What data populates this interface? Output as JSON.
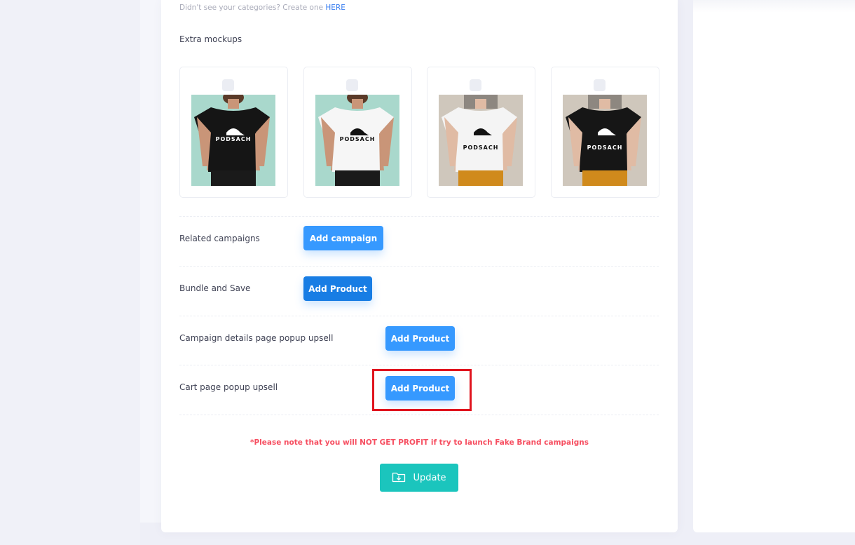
{
  "hint": {
    "text": "Didn't see your categories? Create one",
    "link": "HERE"
  },
  "extra_mockups": {
    "label": "Extra mockups",
    "items": [
      {
        "shirt": "#151515",
        "background": "#a9d8cc",
        "skin": "#c99578",
        "brand": "PODSACH",
        "model": "man"
      },
      {
        "shirt": "#f6f6f6",
        "background": "#a9d8cc",
        "skin": "#c99578",
        "brand": "PODSACH",
        "model": "man"
      },
      {
        "shirt": "#f4f4f4",
        "background": "#cfc7bc",
        "skin": "#e0bba4",
        "brand": "PODSACH",
        "model": "woman"
      },
      {
        "shirt": "#161616",
        "background": "#cfc7bc",
        "skin": "#e0bba4",
        "brand": "PODSACH",
        "model": "woman"
      }
    ]
  },
  "rows": [
    {
      "label": "Related campaigns",
      "button": "Add campaign"
    },
    {
      "label": "Bundle and Save",
      "button": "Add Product"
    },
    {
      "label": "Campaign details page popup upsell",
      "button": "Add Product"
    },
    {
      "label": "Cart page popup upsell",
      "button": "Add Product"
    }
  ],
  "note": "*Please note that you will NOT GET PROFIT if try to launch Fake Brand campaigns",
  "update": {
    "label": "Update",
    "icon": "folder-download-icon"
  },
  "colors": {
    "primary": "#3699ff",
    "primary_active": "#187de4",
    "success": "#1bc5bd",
    "danger": "#f64e60",
    "highlight": "#e0141e"
  }
}
